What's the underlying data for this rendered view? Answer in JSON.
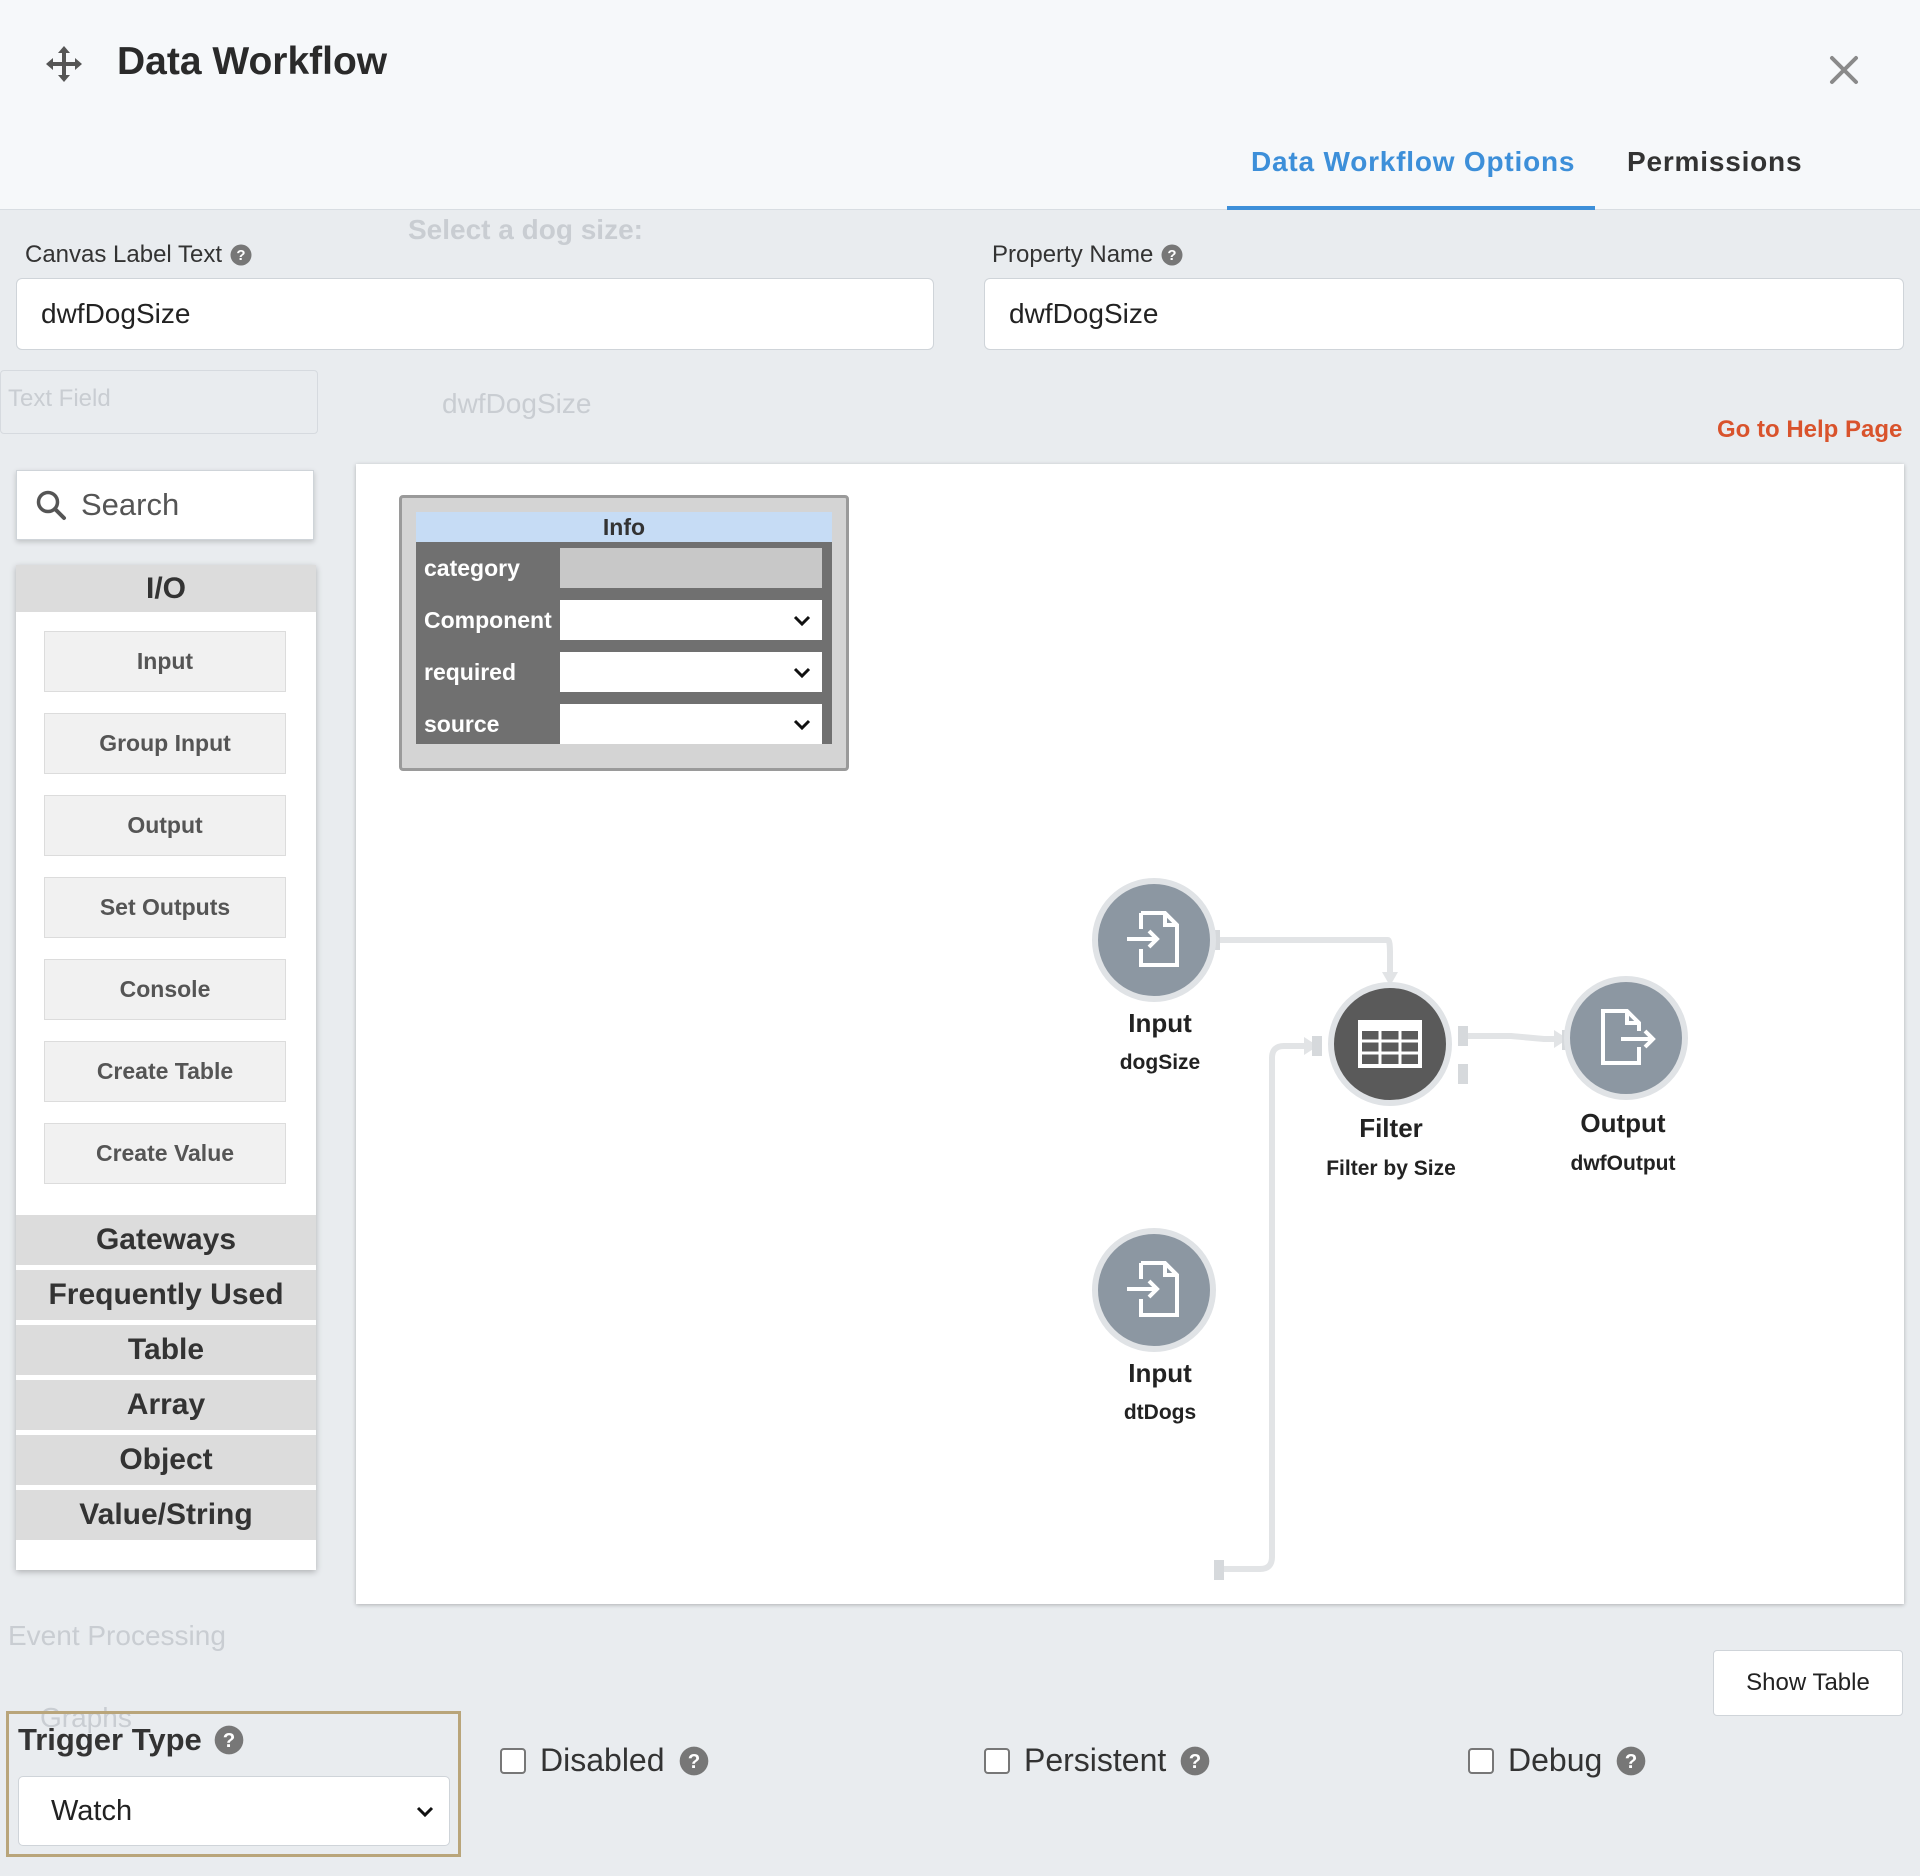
{
  "window": {
    "title": "Data Workflow",
    "tabs": [
      {
        "label": "Data Workflow Options",
        "active": true
      },
      {
        "label": "Permissions",
        "active": false
      }
    ],
    "accent_color": "#3d8fd9"
  },
  "background": {
    "dog_size_label": "Select a dog size:",
    "text_field_label": "Text Field",
    "dwf_label": "dwfDogSize",
    "event_processing_label": "Event Processing",
    "graphs_label": "Graphs"
  },
  "fields": {
    "canvas_label_text": {
      "label": "Canvas Label Text",
      "value": "dwfDogSize"
    },
    "property_name": {
      "label": "Property Name",
      "value": "dwfDogSize"
    }
  },
  "help_link": "Go to Help Page",
  "palette": {
    "search_placeholder": "Search",
    "io_category": "I/O",
    "io_blocks": [
      "Input",
      "Group Input",
      "Output",
      "Set Outputs",
      "Console",
      "Create Table",
      "Create Value"
    ],
    "categories": [
      "Gateways",
      "Frequently Used",
      "Table",
      "Array",
      "Object",
      "Value/String"
    ]
  },
  "info_block": {
    "title": "Info",
    "rows": [
      {
        "label": "category",
        "value": ""
      },
      {
        "label": "Component",
        "value": ""
      },
      {
        "label": "required",
        "value": ""
      },
      {
        "label": "source",
        "value": ""
      }
    ]
  },
  "nodes": {
    "input_dogsize": {
      "title": "Input",
      "subtitle": "dogSize",
      "icon": "input-file-icon"
    },
    "filter": {
      "title": "Filter",
      "subtitle": "Filter by Size",
      "icon": "table-icon"
    },
    "output": {
      "title": "Output",
      "subtitle": "dwfOutput",
      "icon": "output-file-icon"
    },
    "input_dtdogs": {
      "title": "Input",
      "subtitle": "dtDogs",
      "icon": "input-file-icon"
    }
  },
  "bottom": {
    "show_table": "Show Table",
    "trigger_type": {
      "label": "Trigger Type",
      "value": "Watch"
    },
    "disabled": {
      "label": "Disabled",
      "checked": false
    },
    "persistent": {
      "label": "Persistent",
      "checked": false
    },
    "debug": {
      "label": "Debug",
      "checked": false
    }
  }
}
